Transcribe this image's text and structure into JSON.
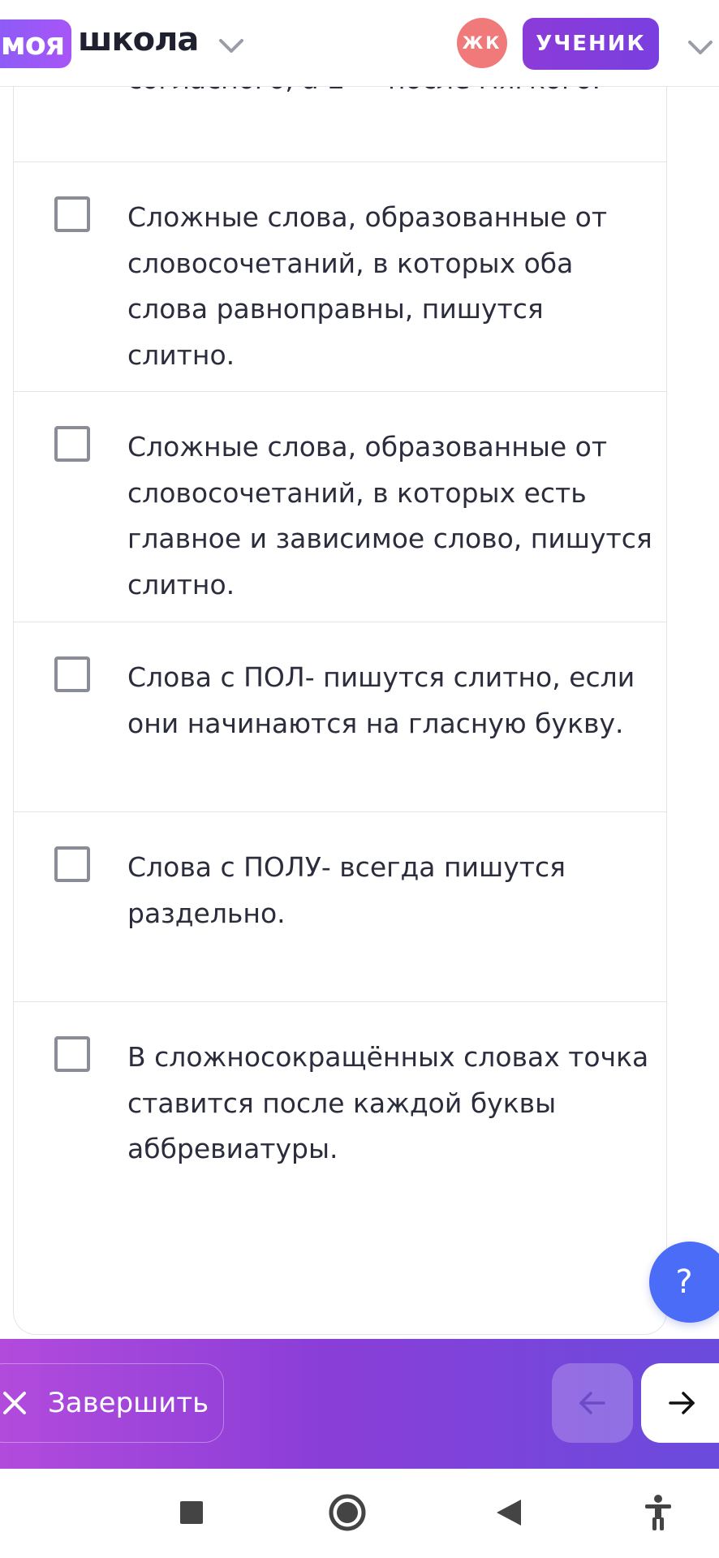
{
  "header": {
    "logo_badge": "моя",
    "logo_text": "школа",
    "avatar_initials": "ЖК",
    "role": "УЧЕНИК"
  },
  "previous_option_tail": "согласного, а Ё — после мягкого.",
  "options": [
    {
      "text": "Сложные слова, образованные от словосочетаний, в которых оба слова равноправны, пишутся слитно.",
      "checked": false
    },
    {
      "text": "Сложные слова, образованные от словосочетаний, в которых есть главное и зависимое слово, пишутся слитно.",
      "checked": false
    },
    {
      "text": "Слова с ПОЛ- пишутся слитно, если они начинаются на гласную букву.",
      "checked": false
    },
    {
      "text": "Слова с ПОЛУ- всегда пишутся раздельно.",
      "checked": false
    },
    {
      "text": "В сложносокращённых словах точка ставится после каждой буквы аббревиатуры.",
      "checked": false
    }
  ],
  "help_label": "?",
  "actions": {
    "finish_label": "Завершить"
  },
  "colors": {
    "brand_purple": "#8b5cf6",
    "avatar": "#f07a7a",
    "help_blue": "#4a6cf7",
    "bar_gradient_start": "#b24bdc",
    "bar_gradient_end": "#6a4bdc"
  },
  "icons": {
    "logo_chevron": "chevron-down-icon",
    "role_chevron": "chevron-down-icon",
    "finish": "close-icon",
    "prev": "arrow-left-icon",
    "next": "arrow-right-icon",
    "nav": [
      "recents-square-icon",
      "home-circle-icon",
      "back-triangle-icon",
      "accessibility-icon"
    ]
  }
}
